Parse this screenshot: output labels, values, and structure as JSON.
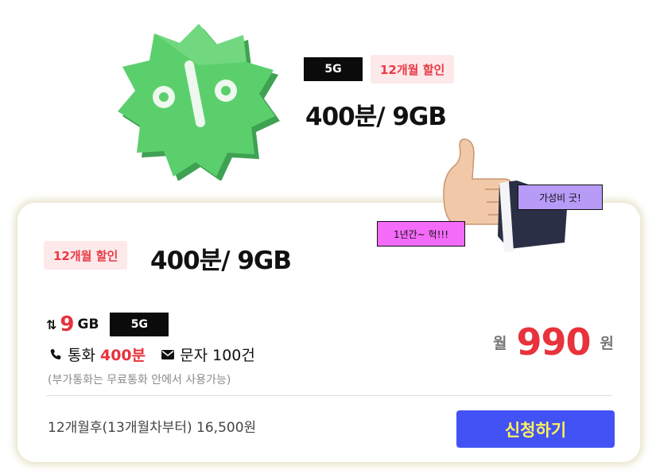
{
  "hero": {
    "tag_5g": "5G",
    "discount_tag": "12개월 할인",
    "plan_title": "400분/ 9GB"
  },
  "card": {
    "discount_tag": "12개월 할인",
    "plan_title": "400분/ 9GB",
    "data_arrows": "⇅",
    "data_amount": "9",
    "data_unit": "GB",
    "tag_5g": "5G",
    "call_label": "통화",
    "call_amount": "400분",
    "sms_label": "문자 100건",
    "note": "(부가통화는 무료통화 안에서 사용가능)",
    "price_prefix": "월",
    "price_value": "990",
    "price_suffix": "원",
    "after_price": "12개월후(13개월차부터) 16,500원",
    "apply_button": "신청하기"
  },
  "bubbles": {
    "left": "1년간~ 헉!!!",
    "right": "가성비 굿!"
  },
  "icons": {
    "badge": "percent-badge-icon",
    "thumbs_up": "thumbs-up-icon",
    "phone": "phone-icon",
    "mail": "mail-icon"
  },
  "colors": {
    "accent_red": "#e8323c",
    "discount_bg": "#fde8ea",
    "button_bg": "#4352f4",
    "button_text": "#fff25a",
    "badge_green": "#5ccf6d"
  }
}
